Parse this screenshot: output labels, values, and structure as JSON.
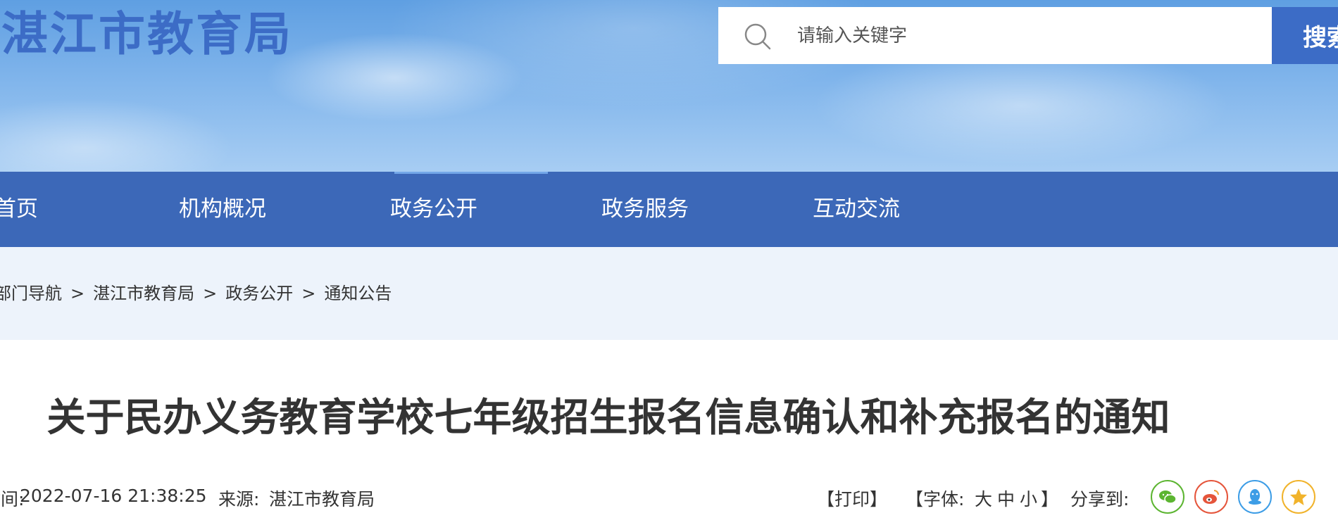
{
  "header": {
    "site_title": "湛江市教育局",
    "search": {
      "placeholder": "请输入关键字",
      "button_label": "搜索"
    }
  },
  "nav": {
    "items": [
      "首页",
      "机构概况",
      "政务公开",
      "政务服务",
      "互动交流"
    ],
    "active": "政务公开"
  },
  "breadcrumb": {
    "items": [
      "部门导航",
      "湛江市教育局",
      "政务公开",
      "通知公告"
    ],
    "separator": ">"
  },
  "article": {
    "title": "关于民办义务教育学校七年级招生报名信息确认和补充报名的通知",
    "publish_time_label": "时间:",
    "publish_time": "2022-07-16 21:38:25",
    "source_label": "来源:",
    "source": "湛江市教育局"
  },
  "tools": {
    "print_label": "【打印】",
    "font_label": "【字体:",
    "font_large": "大",
    "font_medium": "中",
    "font_small": "小",
    "font_close": "】",
    "share_label": "分享到:",
    "share_icons": [
      "wechat-icon",
      "weibo-icon",
      "qq-icon",
      "qzone-icon"
    ]
  },
  "colors": {
    "brand_blue": "#3c6cc6",
    "nav_blue": "#3c68b8",
    "breadcrumb_bg": "#edf3fb",
    "wechat": "#5cb531",
    "weibo": "#e5553b",
    "qq": "#3d9de6",
    "qzone": "#f1b32b"
  }
}
